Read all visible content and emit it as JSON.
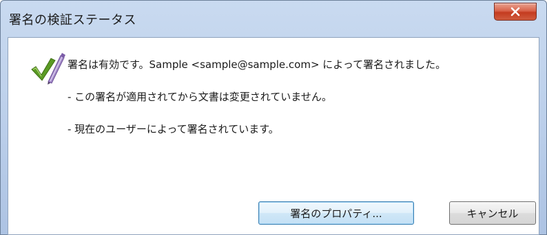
{
  "window": {
    "title": "署名の検証ステータス"
  },
  "message": {
    "line1": "署名は有効です。Sample <sample@sample.com> によって署名されました。",
    "line2": "- この署名が適用されてから文書は変更されていません。",
    "line3": "- 現在のユーザーによって署名されています。"
  },
  "buttons": {
    "properties_label": "署名のプロパティ...",
    "cancel_label": "キャンセル"
  },
  "icons": {
    "status": "signature-valid-check-icon",
    "close": "close-icon"
  },
  "colors": {
    "titlebar": "#b9cde9",
    "close_button": "#c43b20",
    "check_green": "#4f8a1f",
    "pen_purple": "#9b7fc4",
    "default_button_border": "#3c7fb1"
  }
}
